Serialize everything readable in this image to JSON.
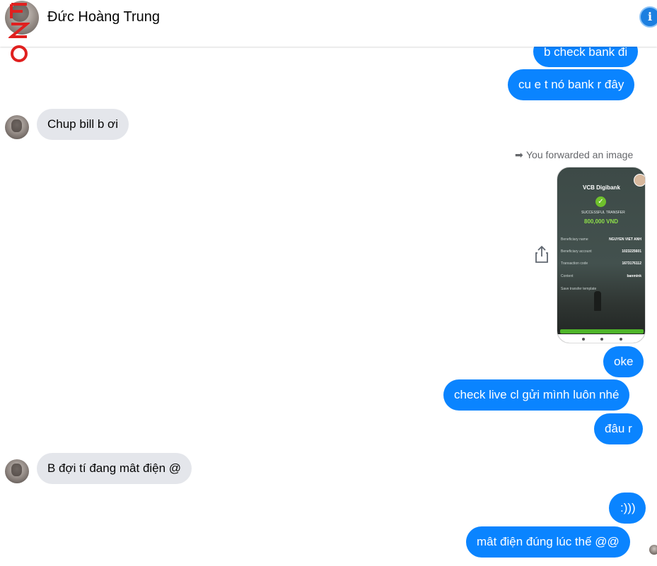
{
  "header": {
    "contact_name": "Đức Hoàng Trung",
    "info_icon": "info-icon"
  },
  "messages": {
    "m1": "b check bank đi",
    "m2": "cu e t nó bank r đây",
    "m3": "Chup bill b ơi",
    "forwarded_label": "You forwarded an image",
    "m5": "oke",
    "m6": "check live cl gửi mình luôn nhé",
    "m7": "đâu r",
    "m8": "B đợi tí đang mât điện @",
    "m9": ":)))",
    "m10": "mât điện đúng lúc thế @@"
  },
  "receipt": {
    "bank": "VCB Digibank",
    "status": "SUCCESSFUL TRANSFER",
    "amount": "800,000 VND",
    "beneficiary_label": "Beneficiary name",
    "beneficiary_value": "NGUYEN VIET ANH",
    "account_label": "Beneficiary account",
    "account_value": "1023225601",
    "code_label": "Transaction code",
    "code_value": "1673176112",
    "content_label": "Content",
    "content_value": "banmink",
    "save_label": "Save transfer template"
  },
  "colors": {
    "outgoing_bubble": "#0a84ff",
    "incoming_bubble": "#e4e6eb",
    "accent": "#1c7fe0"
  }
}
